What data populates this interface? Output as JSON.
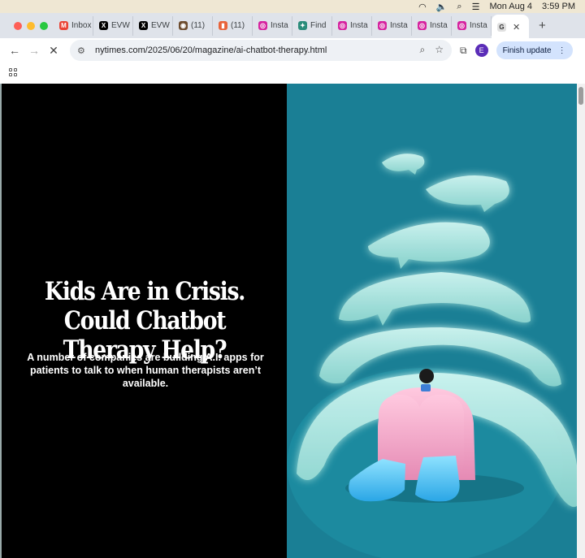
{
  "menubar": {
    "date": "Mon Aug 4",
    "time": "3:59 PM"
  },
  "tabs": [
    {
      "label": "Inbox",
      "icon": "gmail-icon",
      "color": "#ea4335",
      "glyph": "M"
    },
    {
      "label": "EVW",
      "icon": "x-icon",
      "color": "#000000",
      "glyph": "X"
    },
    {
      "label": "EVW",
      "icon": "x-icon",
      "color": "#000000",
      "glyph": "X"
    },
    {
      "label": "(11)",
      "icon": "site-icon",
      "color": "#6d4c2e",
      "glyph": "◉"
    },
    {
      "label": "(11)",
      "icon": "bookmark-site-icon",
      "color": "#e8633a",
      "glyph": "▮"
    },
    {
      "label": "Insta",
      "icon": "instagram-icon",
      "color": "#d6249f",
      "glyph": "◎"
    },
    {
      "label": "Find",
      "icon": "globe-icon",
      "color": "#2a8c7a",
      "glyph": "✦"
    },
    {
      "label": "Insta",
      "icon": "instagram-icon",
      "color": "#d6249f",
      "glyph": "◎"
    },
    {
      "label": "Insta",
      "icon": "instagram-icon",
      "color": "#d6249f",
      "glyph": "◎"
    },
    {
      "label": "Insta",
      "icon": "instagram-icon",
      "color": "#d6249f",
      "glyph": "◎"
    },
    {
      "label": "Insta",
      "icon": "instagram-icon",
      "color": "#d6249f",
      "glyph": "◎"
    }
  ],
  "active_tab": {
    "icon": "loading-icon",
    "glyph": "G"
  },
  "toolbar": {
    "url": "nytimes.com/2025/06/20/magazine/ai-chatbot-therapy.html",
    "avatar_letter": "E",
    "finish_update_label": "Finish update"
  },
  "article": {
    "headline": "Kids Are in Crisis. Could Chatbot Therapy Help?",
    "dek": "A number of companies are building A.I. apps for patients to talk to when human therapists aren’t available."
  },
  "colors": {
    "illustration_bg": "#1a7f95",
    "left_panel_bg": "#000000",
    "bubble": "#bdf0e8",
    "figure_pink": "#f3a2c4",
    "figure_blue": "#58c4f0"
  }
}
